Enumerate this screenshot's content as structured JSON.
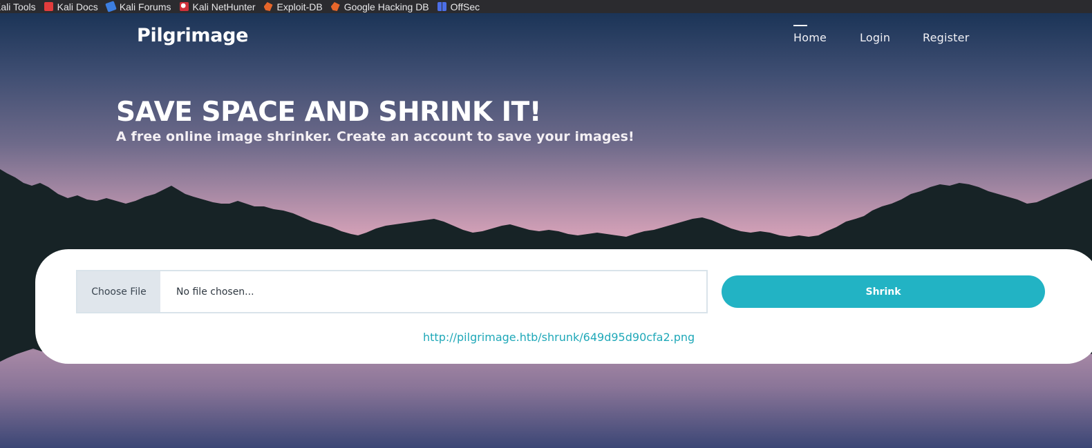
{
  "bookmarks": [
    {
      "label": "Kali Tools",
      "icon": "kali-tools-icon"
    },
    {
      "label": "Kali Docs",
      "icon": "kali-docs-icon"
    },
    {
      "label": "Kali Forums",
      "icon": "kali-forums-icon"
    },
    {
      "label": "Kali NetHunter",
      "icon": "kali-nethunter-icon"
    },
    {
      "label": "Exploit-DB",
      "icon": "exploit-db-icon"
    },
    {
      "label": "Google Hacking DB",
      "icon": "google-hacking-db-icon"
    },
    {
      "label": "OffSec",
      "icon": "offsec-icon"
    }
  ],
  "site": {
    "brand": "Pilgrimage",
    "nav": [
      {
        "label": "Home",
        "active": true
      },
      {
        "label": "Login",
        "active": false
      },
      {
        "label": "Register",
        "active": false
      }
    ]
  },
  "hero": {
    "title": "SAVE SPACE AND SHRINK IT!",
    "subtitle": "A free online image shrinker. Create an account to save your images!"
  },
  "upload": {
    "choose_label": "Choose File",
    "file_status": "No file chosen...",
    "submit_label": "Shrink",
    "result_url": "http://pilgrimage.htb/shrunk/649d95d90cfa2.png"
  },
  "colors": {
    "accent": "#22b3c4",
    "link": "#1fa8b8",
    "mountain": "#172326"
  }
}
